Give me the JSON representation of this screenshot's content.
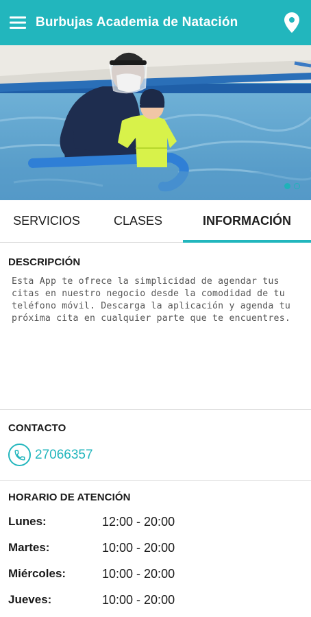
{
  "appbar": {
    "title": "Burbujas Academia de Natación",
    "color": "#22b6bd",
    "menu_icon": "menu-icon",
    "location_icon": "location-pin-icon"
  },
  "hero": {
    "carousel_count": 2,
    "active_index": 0
  },
  "tabs": [
    {
      "label": "SERVICIOS",
      "active": false
    },
    {
      "label": "CLASES",
      "active": false
    },
    {
      "label": "INFORMACIÓN",
      "active": true
    }
  ],
  "description": {
    "title": "DESCRIPCIÓN",
    "text": "Esta App te ofrece la simplicidad de agendar tus citas en nuestro negocio desde la comodidad de tu teléfono móvil. Descarga la aplicación y agenda tu próxima cita en cualquier parte que te encuentres."
  },
  "contact": {
    "title": "CONTACTO",
    "phone": "27066357",
    "phone_icon": "phone-icon"
  },
  "hours": {
    "title": "HORARIO DE ATENCIÓN",
    "rows": [
      {
        "day": "Lunes:",
        "time": "12:00 - 20:00"
      },
      {
        "day": "Martes:",
        "time": "10:00 - 20:00"
      },
      {
        "day": "Miércoles:",
        "time": "10:00 - 20:00"
      },
      {
        "day": "Jueves:",
        "time": "10:00 - 20:00"
      }
    ]
  }
}
